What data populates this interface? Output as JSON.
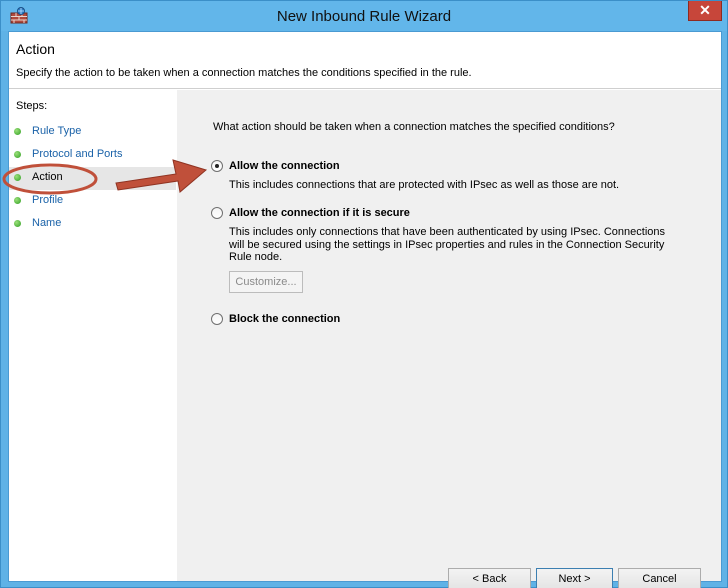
{
  "window": {
    "title": "New Inbound Rule Wizard",
    "close_label": "✕",
    "app_icon": "firewall-brick-wall-icon"
  },
  "header": {
    "title": "Action",
    "description": "Specify the action to be taken when a connection matches the conditions specified in the rule."
  },
  "sidebar": {
    "steps_label": "Steps:",
    "items": [
      {
        "label": "Rule Type",
        "current": false
      },
      {
        "label": "Protocol and Ports",
        "current": false
      },
      {
        "label": "Action",
        "current": true
      },
      {
        "label": "Profile",
        "current": false
      },
      {
        "label": "Name",
        "current": false
      }
    ]
  },
  "main": {
    "question": "What action should be taken when a connection matches the specified conditions?",
    "options": [
      {
        "label": "Allow the connection",
        "description": "This includes connections that are protected with IPsec as well as those are not.",
        "selected": true
      },
      {
        "label": "Allow the connection if it is secure",
        "description_lines": [
          "This includes only connections that have been authenticated by using IPsec.  Connections",
          "will be secured using the settings in IPsec properties and rules in the Connection Security",
          "Rule node."
        ],
        "selected": false
      },
      {
        "label": "Block the connection",
        "selected": false
      }
    ],
    "customize_label": "Customize..."
  },
  "buttons": {
    "back": "< Back",
    "next": "Next >",
    "cancel": "Cancel"
  },
  "annotation": {
    "highlight_color": "#c0503a"
  }
}
